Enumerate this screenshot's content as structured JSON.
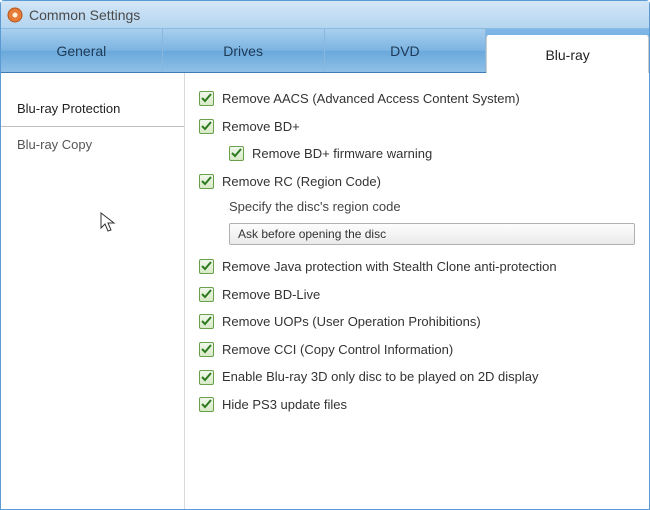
{
  "window": {
    "title": "Common Settings"
  },
  "tabs": [
    {
      "label": "General"
    },
    {
      "label": "Drives"
    },
    {
      "label": "DVD"
    },
    {
      "label": "Blu-ray"
    }
  ],
  "sidebar": {
    "items": [
      {
        "label": "Blu-ray Protection"
      },
      {
        "label": "Blu-ray Copy"
      }
    ]
  },
  "options": {
    "remove_aacs": "Remove AACS (Advanced Access Content System)",
    "remove_bdplus": "Remove BD+",
    "remove_bdplus_fw": "Remove BD+ firmware warning",
    "remove_rc": "Remove RC (Region Code)",
    "region_label": "Specify the disc's region code",
    "region_value": "Ask before opening the disc",
    "remove_java": "Remove Java protection with Stealth Clone anti-protection",
    "remove_bdlive": "Remove BD-Live",
    "remove_uops": "Remove UOPs (User Operation Prohibitions)",
    "remove_cci": "Remove CCI (Copy Control Information)",
    "enable_3d": "Enable Blu-ray 3D only disc to be played on 2D display",
    "hide_ps3": "Hide PS3 update files"
  }
}
